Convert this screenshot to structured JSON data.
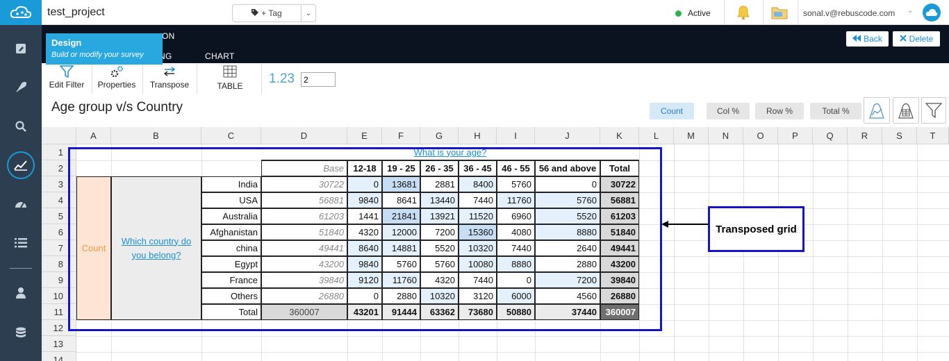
{
  "header": {
    "project_title": "test_project",
    "tag_label": "+ Tag",
    "status": "Active",
    "user_email": "sonal.v@rebuscode.com"
  },
  "nav_tabs": [
    {
      "label": "ON"
    },
    {
      "label": "NG"
    },
    {
      "label": "CHART"
    }
  ],
  "tooltip": {
    "title": "Design",
    "subtitle": "Build or modify your survey"
  },
  "actions": {
    "back": "Back",
    "delete": "Delete"
  },
  "toolbar": {
    "edit_filter": "Edit Filter",
    "properties": "Properties",
    "transpose": "Transpose",
    "table": "TABLE",
    "decimals_label": "1.23",
    "decimals_value": "2"
  },
  "title": "Age group v/s Country",
  "view_buttons": [
    {
      "label": "Count",
      "selected": true
    },
    {
      "label": "Col %",
      "selected": false
    },
    {
      "label": "Row %",
      "selected": false
    },
    {
      "label": "Total %",
      "selected": false
    }
  ],
  "sheet": {
    "columns": [
      "A",
      "B",
      "C",
      "D",
      "E",
      "F",
      "G",
      "H",
      "I",
      "J",
      "K",
      "L",
      "M",
      "N",
      "O",
      "P",
      "Q",
      "R",
      "S",
      "T"
    ],
    "rows": [
      "1",
      "2",
      "3",
      "4",
      "5",
      "6",
      "7",
      "8",
      "9",
      "10",
      "11",
      "12",
      "13",
      "14"
    ]
  },
  "table": {
    "question_age": "What is your age?",
    "base_label": "Base",
    "age_groups": [
      "12-18",
      "19 - 25",
      "26 - 35",
      "36 - 45",
      "46 - 55",
      "56 and above"
    ],
    "total_label": "Total",
    "count_label": "Count",
    "question_country": "Which country do you belong?",
    "rows": [
      {
        "country": "India",
        "base": "30722",
        "values": [
          "0",
          "13681",
          "2881",
          "8400",
          "5760",
          "0"
        ],
        "total": "30722"
      },
      {
        "country": "USA",
        "base": "56881",
        "values": [
          "9840",
          "8641",
          "13440",
          "7440",
          "11760",
          "5760"
        ],
        "total": "56881"
      },
      {
        "country": "Australia",
        "base": "61203",
        "values": [
          "1441",
          "21841",
          "13921",
          "11520",
          "6960",
          "5520"
        ],
        "total": "61203"
      },
      {
        "country": "Afghanistan",
        "base": "51840",
        "values": [
          "4320",
          "12000",
          "7200",
          "15360",
          "4080",
          "8880"
        ],
        "total": "51840"
      },
      {
        "country": "china",
        "base": "49441",
        "values": [
          "8640",
          "14881",
          "5520",
          "10320",
          "7440",
          "2640"
        ],
        "total": "49441"
      },
      {
        "country": "Egypt",
        "base": "43200",
        "values": [
          "9840",
          "5760",
          "5760",
          "10080",
          "8880",
          "2880"
        ],
        "total": "43200"
      },
      {
        "country": "France",
        "base": "39840",
        "values": [
          "9120",
          "11760",
          "4320",
          "7440",
          "0",
          "7200"
        ],
        "total": "39840"
      },
      {
        "country": "Others",
        "base": "26880",
        "values": [
          "0",
          "2880",
          "10320",
          "3120",
          "6000",
          "4560"
        ],
        "total": "26880"
      }
    ],
    "totals_row": {
      "label": "Total",
      "base": "360007",
      "values": [
        "43201",
        "91444",
        "63362",
        "73680",
        "50880",
        "37440"
      ],
      "total": "360007"
    }
  },
  "annotation": "Transposed grid"
}
